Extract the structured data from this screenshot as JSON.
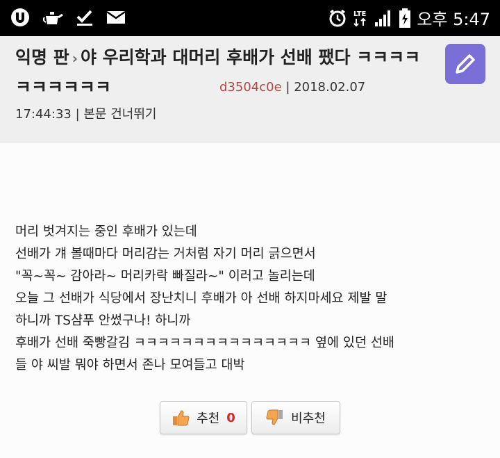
{
  "status_bar": {
    "left_icons": [
      "app-notification-icon",
      "kettle-icon",
      "checkmark-icon",
      "mail-icon"
    ],
    "network": "LTE",
    "time": "오후 5:47",
    "right_icons": [
      "alarm-icon",
      "lte-icon",
      "signal-icon",
      "battery-charging-icon"
    ]
  },
  "post": {
    "board": "익명 판",
    "separator": "›",
    "title": "야 우리학과 대머리 후배가 선배 팼다 ㅋㅋㅋㅋㅋㅋㅋㅋㅋㅋ",
    "user_id": "d3504c0e",
    "date": "2018.02.07",
    "time": "17:44:33",
    "skip_link": "본문 건너뛰기",
    "body": "머리 벗겨지는 중인 후배가 있는데\n선배가 걔 볼때마다 머리감는 거처럼 자기 머리 긁으면서\n\"꼭~꼭~ 감아라~ 머리카락 빠질라~\" 이러고 놀리는데\n오늘 그 선배가 식당에서 장난치니 후배가 아 선배 하지마세요 제발 말\n하니까 TS샴푸 안썼구나! 하니까\n후배가 선배 죽빵갈김 ㅋㅋㅋㅋㅋㅋㅋㅋㅋㅋㅋㅋㅋㅋㅋ 옆에 있던 선배\n들 야 씨발 뭐야 하면서 존나 모여들고 대박"
  },
  "votes": {
    "recommend_label": "추천",
    "recommend_count": "0",
    "not_recommend_label": "비추천"
  },
  "colors": {
    "header_bg": "#efefef",
    "user_id": "#b44848",
    "edit_button": "#7a6fd6",
    "count": "#d42a2a"
  }
}
